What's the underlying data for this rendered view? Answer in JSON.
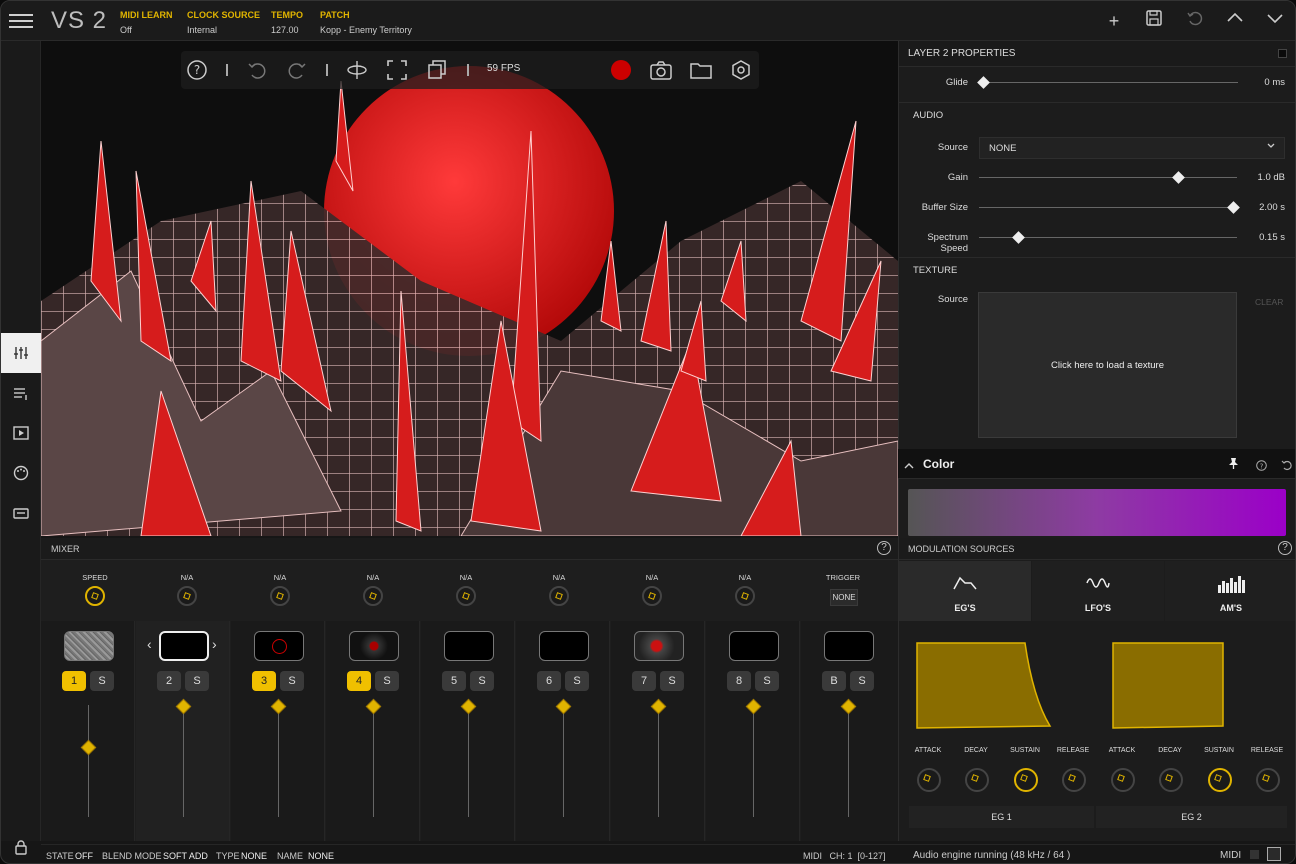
{
  "app": {
    "logo": "VS 2"
  },
  "topbar": {
    "midi_learn_label": "MIDI LEARN",
    "midi_learn_value": "Off",
    "clock_label": "CLOCK SOURCE",
    "clock_value": "Internal",
    "tempo_label": "TEMPO",
    "tempo_value": "127.00",
    "patch_label": "PATCH",
    "patch_value": "Kopp - Enemy Territory",
    "icons": [
      "plus-icon",
      "save-icon",
      "undo-icon",
      "chevron-up-icon",
      "chevron-down-icon"
    ]
  },
  "viewport": {
    "fps": "59 FPS",
    "icons": [
      "help-icon",
      "undo-icon",
      "redo-icon",
      "orbit-icon",
      "fullscreen-icon",
      "clone-icon",
      "record-icon",
      "camera-icon",
      "folder-icon",
      "settings-icon"
    ]
  },
  "layer": {
    "title": "LAYER 2 PROPERTIES",
    "glide_label": "Glide",
    "glide_value": "0 ms",
    "audio_section": "AUDIO",
    "source_label": "Source",
    "source_value": "NONE",
    "gain_label": "Gain",
    "gain_value": "1.0 dB",
    "buffer_label": "Buffer Size",
    "buffer_value": "2.00 s",
    "spectrum_label": "Spectrum Speed",
    "spectrum_value": "0.15 s",
    "texture_section": "TEXTURE",
    "texture_source_label": "Source",
    "texture_clear": "CLEAR",
    "texture_hint": "Click here to load a texture"
  },
  "color": {
    "title": "Color",
    "gradient": [
      "#555555",
      "#8e3ba3",
      "#9b00c8"
    ]
  },
  "mixer": {
    "title": "MIXER",
    "knobs": [
      {
        "label": "SPEED"
      },
      {
        "label": "N/A"
      },
      {
        "label": "N/A"
      },
      {
        "label": "N/A"
      },
      {
        "label": "N/A"
      },
      {
        "label": "N/A"
      },
      {
        "label": "N/A"
      },
      {
        "label": "N/A"
      }
    ],
    "trigger_label": "TRIGGER",
    "trigger_value": "NONE",
    "channels": [
      {
        "num": "1",
        "solo": "S",
        "active": true,
        "level": 0.35
      },
      {
        "num": "2",
        "solo": "S",
        "active": false,
        "level": 1.0
      },
      {
        "num": "3",
        "solo": "S",
        "active": true,
        "level": 1.0
      },
      {
        "num": "4",
        "solo": "S",
        "active": true,
        "level": 1.0
      },
      {
        "num": "5",
        "solo": "S",
        "active": false,
        "level": 1.0
      },
      {
        "num": "6",
        "solo": "S",
        "active": false,
        "level": 1.0
      },
      {
        "num": "7",
        "solo": "S",
        "active": false,
        "level": 1.0
      },
      {
        "num": "8",
        "solo": "S",
        "active": false,
        "level": 1.0
      },
      {
        "num": "B",
        "solo": "S",
        "active": false,
        "level": 1.0
      }
    ]
  },
  "modulation": {
    "title": "MODULATION SOURCES",
    "tabs": [
      "EG'S",
      "LFO'S",
      "AM'S"
    ],
    "eg_labels": [
      "ATTACK",
      "DECAY",
      "SUSTAIN",
      "RELEASE",
      "ATTACK",
      "DECAY",
      "SUSTAIN",
      "RELEASE"
    ],
    "eg1": "EG 1",
    "eg2": "EG 2"
  },
  "status": {
    "state_label": "STATE",
    "state_value": "OFF",
    "blend_label": "BLEND MODE",
    "blend_value": "SOFT ADD",
    "type_label": "TYPE",
    "type_value": "NONE",
    "name_label": "NAME",
    "name_value": "NONE",
    "midi_ch": "MIDI   CH: 1  [0-127]",
    "engine": "Audio engine running (48 kHz / 64 )",
    "midi": "MIDI"
  }
}
